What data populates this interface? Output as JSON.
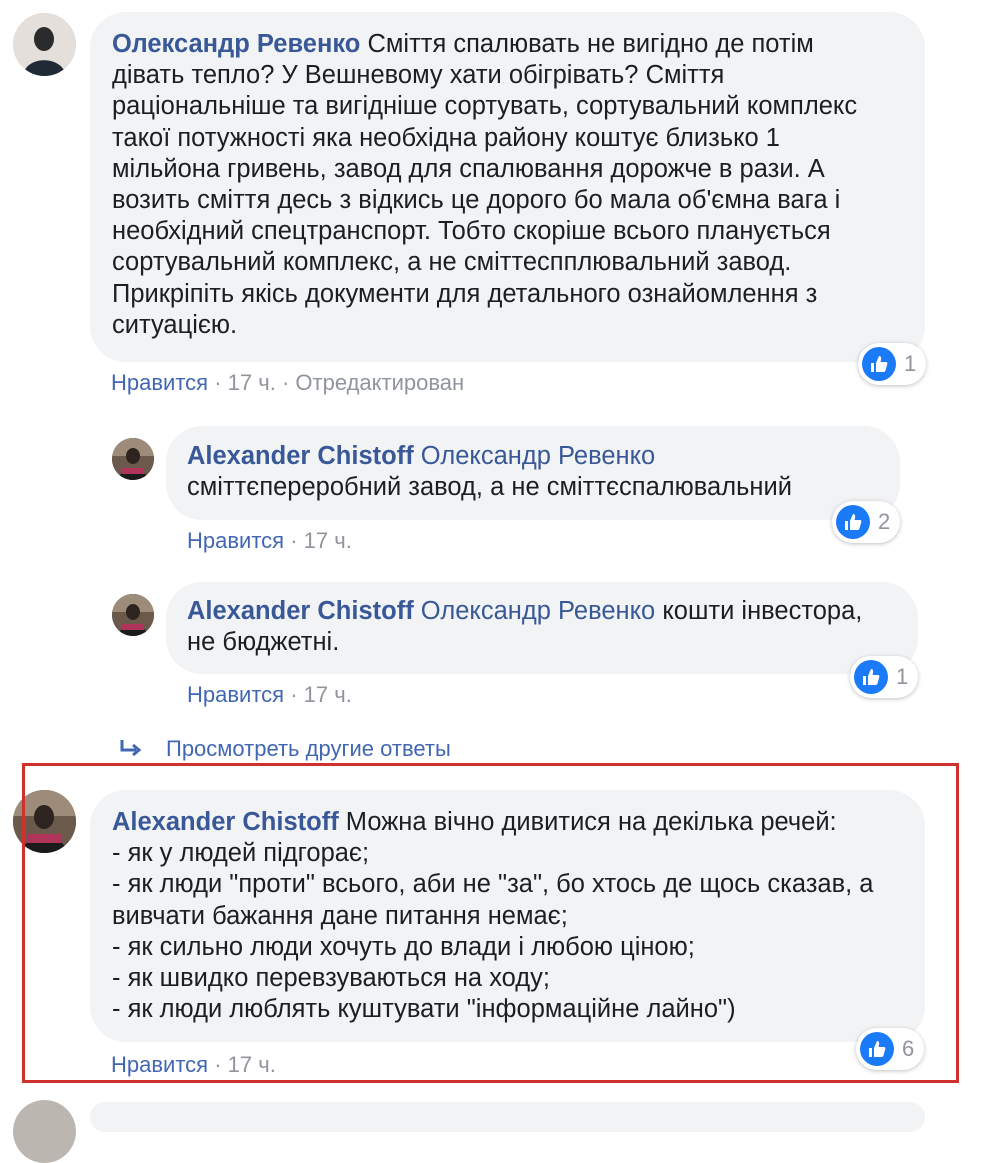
{
  "comments": [
    {
      "author": "Олександр Ревенко",
      "lines": [
        "Сміття спалювать не вигідно де потім",
        "дівать тепло? У Вешневому хати обігрівать? Сміття",
        "раціональніше та вигідніше сортувать, сортувальний комплекс",
        "такої потужності яка необхідна району коштує близько 1",
        "мільйона гривень, завод для спалювання дорожче в рази. А",
        "возить сміття десь з відкись це дорого бо мала об'ємна вага і",
        "необхідний спецтранспорт. Тобто скоріше всього планується",
        "сортувальний комплекс, а не сміттеспплювальний завод.",
        "Прикріпіть якісь документи для детального ознайомлення з",
        "ситуацією."
      ],
      "like_label": "Нравится",
      "time": "17 ч.",
      "edited": "Отредактирован",
      "likes": "1"
    },
    {
      "author": "Alexander Chistoff",
      "mention": "Олександр Ревенко",
      "lines": [
        "сміттєпереробний завод, а не сміттєспалювальний"
      ],
      "like_label": "Нравится",
      "time": "17 ч.",
      "likes": "2"
    },
    {
      "author": "Alexander Chistoff",
      "mention": "Олександр Ревенко",
      "lines": [
        "кошти інвестора,",
        "не бюджетні."
      ],
      "like_label": "Нравится",
      "time": "17 ч.",
      "likes": "1"
    },
    {
      "author": "Alexander Chistoff",
      "lines": [
        "Можна вічно дивитися на декілька речей:",
        "- як у людей підгорає;",
        "- як люди \"проти\" всього, аби не \"за\", бо хтось де щось сказав, а",
        "вивчати бажання дане питання немає;",
        "- як сильно люди хочуть до влади і любою ціною;",
        "- як швидко перевзуваються на ходу;",
        "- як люди люблять куштувати \"інформаційне лайно\")"
      ],
      "like_label": "Нравится",
      "time": "17 ч.",
      "likes": "6"
    }
  ],
  "view_more_replies": "Просмотреть другие ответы",
  "icons": {
    "like": "thumbs-up-icon",
    "reply_arrow": "reply-arrow-icon"
  },
  "colors": {
    "author": "#385898",
    "bubble": "#f2f3f5",
    "like_badge": "#1a7af8",
    "highlight": "#d0312d"
  }
}
